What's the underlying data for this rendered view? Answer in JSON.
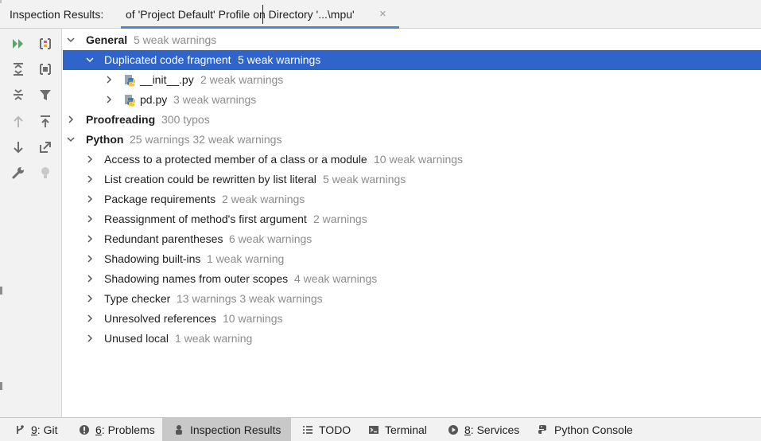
{
  "header": {
    "label": "Inspection Results:",
    "tab_title": "of 'Project Default' Profile on Directory '...\\mpu'",
    "close_glyph": "×"
  },
  "toolbar": {
    "buttons": [
      {
        "name": "rerun-icon",
        "color": "#59a869"
      },
      {
        "name": "group-by-severity-icon",
        "color": "#db5860"
      },
      {
        "name": "expand-all-icon"
      },
      {
        "name": "group-by-directory-icon"
      },
      {
        "name": "collapse-all-icon"
      },
      {
        "name": "filter-icon"
      },
      {
        "name": "previous-problem-icon"
      },
      {
        "name": "export-icon"
      },
      {
        "name": "next-problem-icon"
      },
      {
        "name": "autoscroll-to-source-icon"
      },
      {
        "name": "settings-wrench-icon"
      },
      {
        "name": "quick-fix-bulb-icon"
      }
    ]
  },
  "tree": {
    "rows": [
      {
        "label": "General",
        "count": "5 weak warnings",
        "bold": true,
        "expanded": true,
        "level": 0
      },
      {
        "label": "Duplicated code fragment",
        "count": "5 weak warnings",
        "expanded": true,
        "selected": true,
        "level": 1
      },
      {
        "label": "__init__.py",
        "count": "2 weak warnings",
        "level": 2,
        "icon": "python-file-icon"
      },
      {
        "label": "pd.py",
        "count": "3 weak warnings",
        "level": 2,
        "icon": "python-file-icon"
      },
      {
        "label": "Proofreading",
        "count": "300 typos",
        "bold": true,
        "level": 0
      },
      {
        "label": "Python",
        "count": "25 warnings 32 weak warnings",
        "bold": true,
        "expanded": true,
        "level": 0
      },
      {
        "label": "Access to a protected member of a class or a module",
        "count": "10 weak warnings",
        "level": 1
      },
      {
        "label": "List creation could be rewritten by list literal",
        "count": "5 weak warnings",
        "level": 1
      },
      {
        "label": "Package requirements",
        "count": "2 weak warnings",
        "level": 1
      },
      {
        "label": "Reassignment of method's first argument",
        "count": "2 warnings",
        "level": 1
      },
      {
        "label": "Redundant parentheses",
        "count": "6 weak warnings",
        "level": 1
      },
      {
        "label": "Shadowing built-ins",
        "count": "1 weak warning",
        "level": 1
      },
      {
        "label": "Shadowing names from outer scopes",
        "count": "4 weak warnings",
        "level": 1
      },
      {
        "label": "Type checker",
        "count": "13 warnings 3 weak warnings",
        "level": 1
      },
      {
        "label": "Unresolved references",
        "count": "10 warnings",
        "level": 1
      },
      {
        "label": "Unused local",
        "count": "1 weak warning",
        "level": 1
      }
    ]
  },
  "bottombar": {
    "tabs": [
      {
        "mnemonic": "9",
        "label": ": Git",
        "icon": "git-branch-icon"
      },
      {
        "mnemonic": "6",
        "label": ": Problems",
        "icon": "problems-icon"
      },
      {
        "mnemonic": "",
        "label": "Inspection Results",
        "icon": "inspection-icon",
        "active": true
      },
      {
        "mnemonic": "",
        "label": "TODO",
        "icon": "todo-list-icon"
      },
      {
        "mnemonic": "",
        "label": "Terminal",
        "icon": "terminal-icon"
      },
      {
        "mnemonic": "8",
        "label": ": Services",
        "icon": "services-icon"
      },
      {
        "mnemonic": "",
        "label": "Python Console",
        "icon": "python-console-icon"
      }
    ]
  },
  "colors": {
    "selection": "#2f65ca",
    "accent": "#4a88c7",
    "muted_text": "#8c8c8c",
    "icon_gray": "#6e6e6e"
  }
}
